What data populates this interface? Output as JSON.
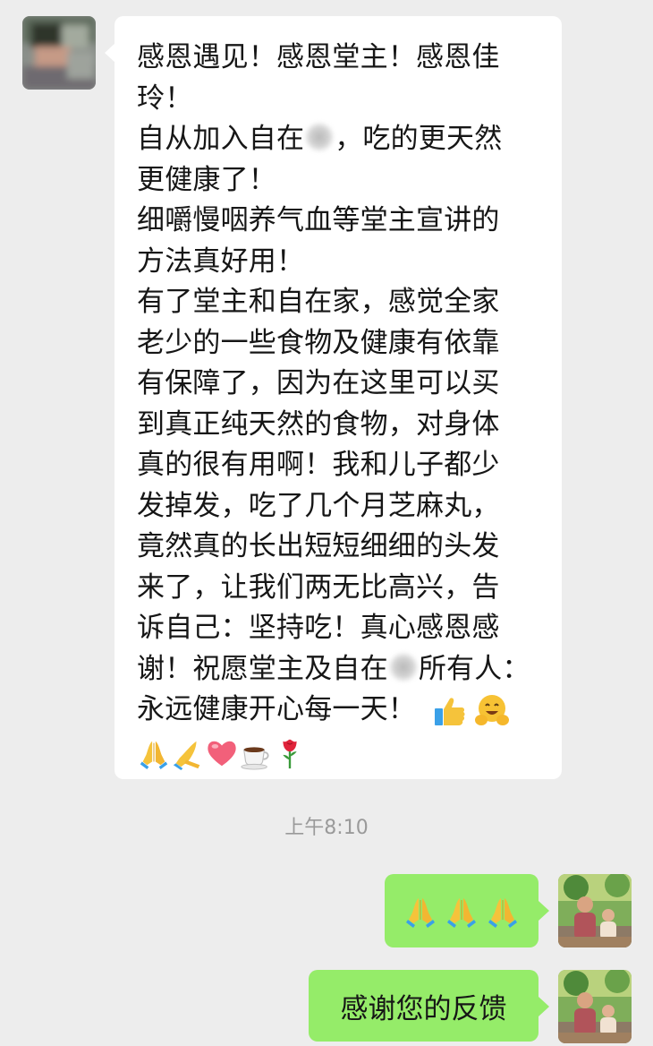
{
  "incoming_message": {
    "lines": [
      "感恩遇见！感恩堂主！感恩佳",
      "玲！",
      "自从加入自在",
      "，吃的更天然",
      "更健康了！",
      "细嚼慢咽养气血等堂主宣讲的",
      "方法真好用！",
      "有了堂主和自在家，感觉全家",
      "老少的一些食物及健康有依靠",
      "有保障了，因为在这里可以买",
      "到真正纯天然的食物，对身体",
      "真的很有用啊！我和儿子都少",
      "发掉发，吃了几个月芝麻丸，",
      "竟然真的长出短短细细的头发",
      "来了，让我们两无比高兴，告",
      "诉自己：坚持吃！真心感恩感",
      "谢！祝愿堂主及自在",
      "所有人：",
      "永远健康开心每一天！"
    ],
    "emojis_line1": [
      "thumbs-up",
      "hugging-face"
    ],
    "emojis_line2": [
      "folded-hands",
      "folded-hands-alt",
      "red-heart",
      "hot-beverage",
      "rose"
    ]
  },
  "timestamp": "上午8:10",
  "outgoing_messages": [
    {
      "emojis": [
        "folded-hands",
        "folded-hands",
        "folded-hands"
      ]
    },
    {
      "text": "感谢您的反馈"
    }
  ],
  "colors": {
    "background": "#ededed",
    "incoming_bubble": "#ffffff",
    "outgoing_bubble": "#95ec69",
    "timestamp": "#9a9a9a"
  }
}
